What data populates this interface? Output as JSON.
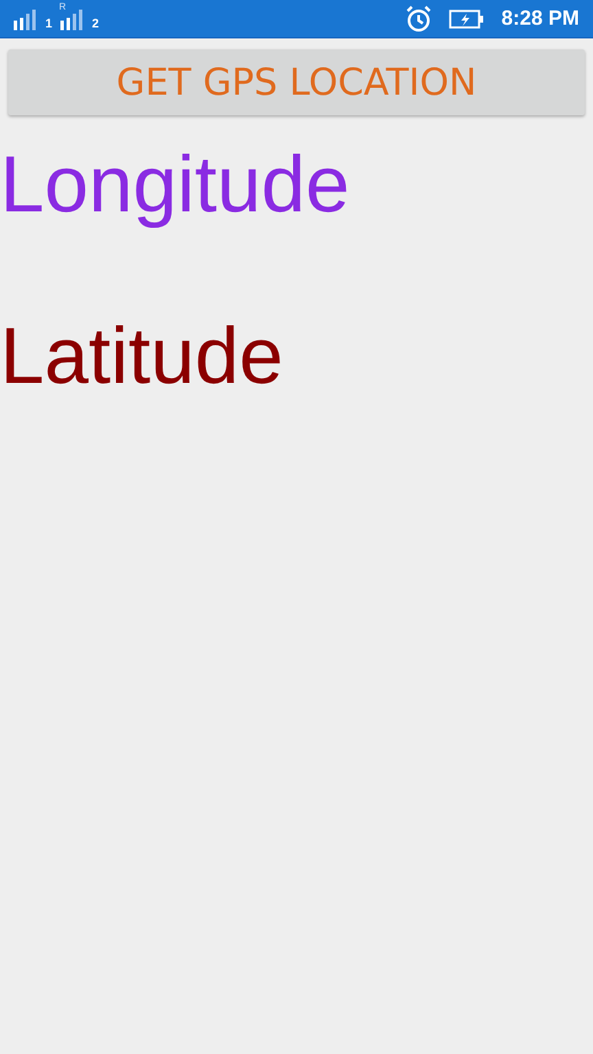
{
  "status_bar": {
    "sims": [
      {
        "slot": "1"
      },
      {
        "slot": "2",
        "roaming": "R"
      }
    ],
    "time": "8:28 PM"
  },
  "button": {
    "label": "GET GPS LOCATION"
  },
  "readings": [
    {
      "text": "Longitude",
      "color": "#8a2be2"
    },
    {
      "text": "Latitude",
      "color": "#8b0000"
    }
  ]
}
